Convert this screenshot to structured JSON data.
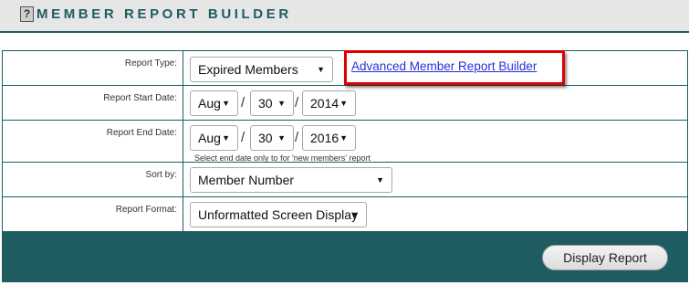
{
  "header": {
    "help_icon": "?",
    "title": "MEMBER REPORT BUILDER"
  },
  "form": {
    "report_type": {
      "label": "Report Type:",
      "value": "Expired Members",
      "advanced_link": "Advanced Member Report Builder"
    },
    "start_date": {
      "label": "Report Start Date:",
      "month": "Aug",
      "day": "30",
      "year": "2014",
      "separator": "/"
    },
    "end_date": {
      "label": "Report End Date:",
      "month": "Aug",
      "day": "30",
      "year": "2016",
      "separator": "/",
      "note": "Select end date only to for 'new members' report"
    },
    "sort_by": {
      "label": "Sort by:",
      "value": "Member Number"
    },
    "report_format": {
      "label": "Report Format:",
      "value": "Unformatted Screen Display"
    },
    "submit_label": "Display Report"
  },
  "colors": {
    "accent": "#1f5c61",
    "highlight": "#e00000",
    "link": "#2a2fd6"
  },
  "icons": {
    "help": "help-icon",
    "dropdown": "chevron-down-icon"
  }
}
